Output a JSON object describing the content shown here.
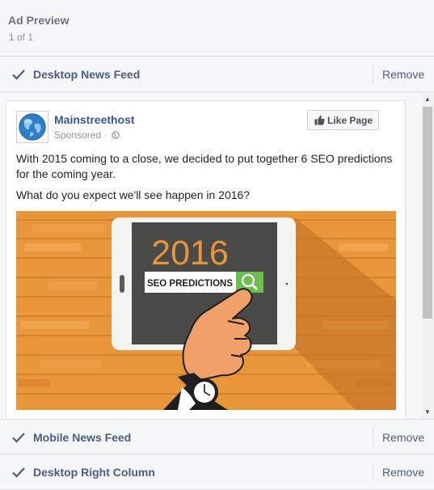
{
  "header": {
    "title": "Ad Preview",
    "count": "1 of 1"
  },
  "placements": [
    {
      "label": "Desktop News Feed",
      "remove": "Remove"
    },
    {
      "label": "Mobile News Feed",
      "remove": "Remove"
    },
    {
      "label": "Desktop Right Column",
      "remove": "Remove"
    }
  ],
  "post": {
    "page_name": "Mainstreethost",
    "sponsored": "Sponsored ·",
    "like_button": "Like Page",
    "text_line1": "With 2015 coming to a close, we decided to put together 6 SEO predictions for the coming year.",
    "text_line2": "What do you expect we'll see happen in 2016?",
    "image": {
      "year": "2016",
      "search_text": "SEO PREDICTIONS"
    }
  },
  "colors": {
    "link_blue": "#365899",
    "section_blue": "#4b5d81",
    "wood_orange": "#e9953a",
    "tablet_screen": "#4a4a48",
    "search_green": "#6bbf4e"
  }
}
